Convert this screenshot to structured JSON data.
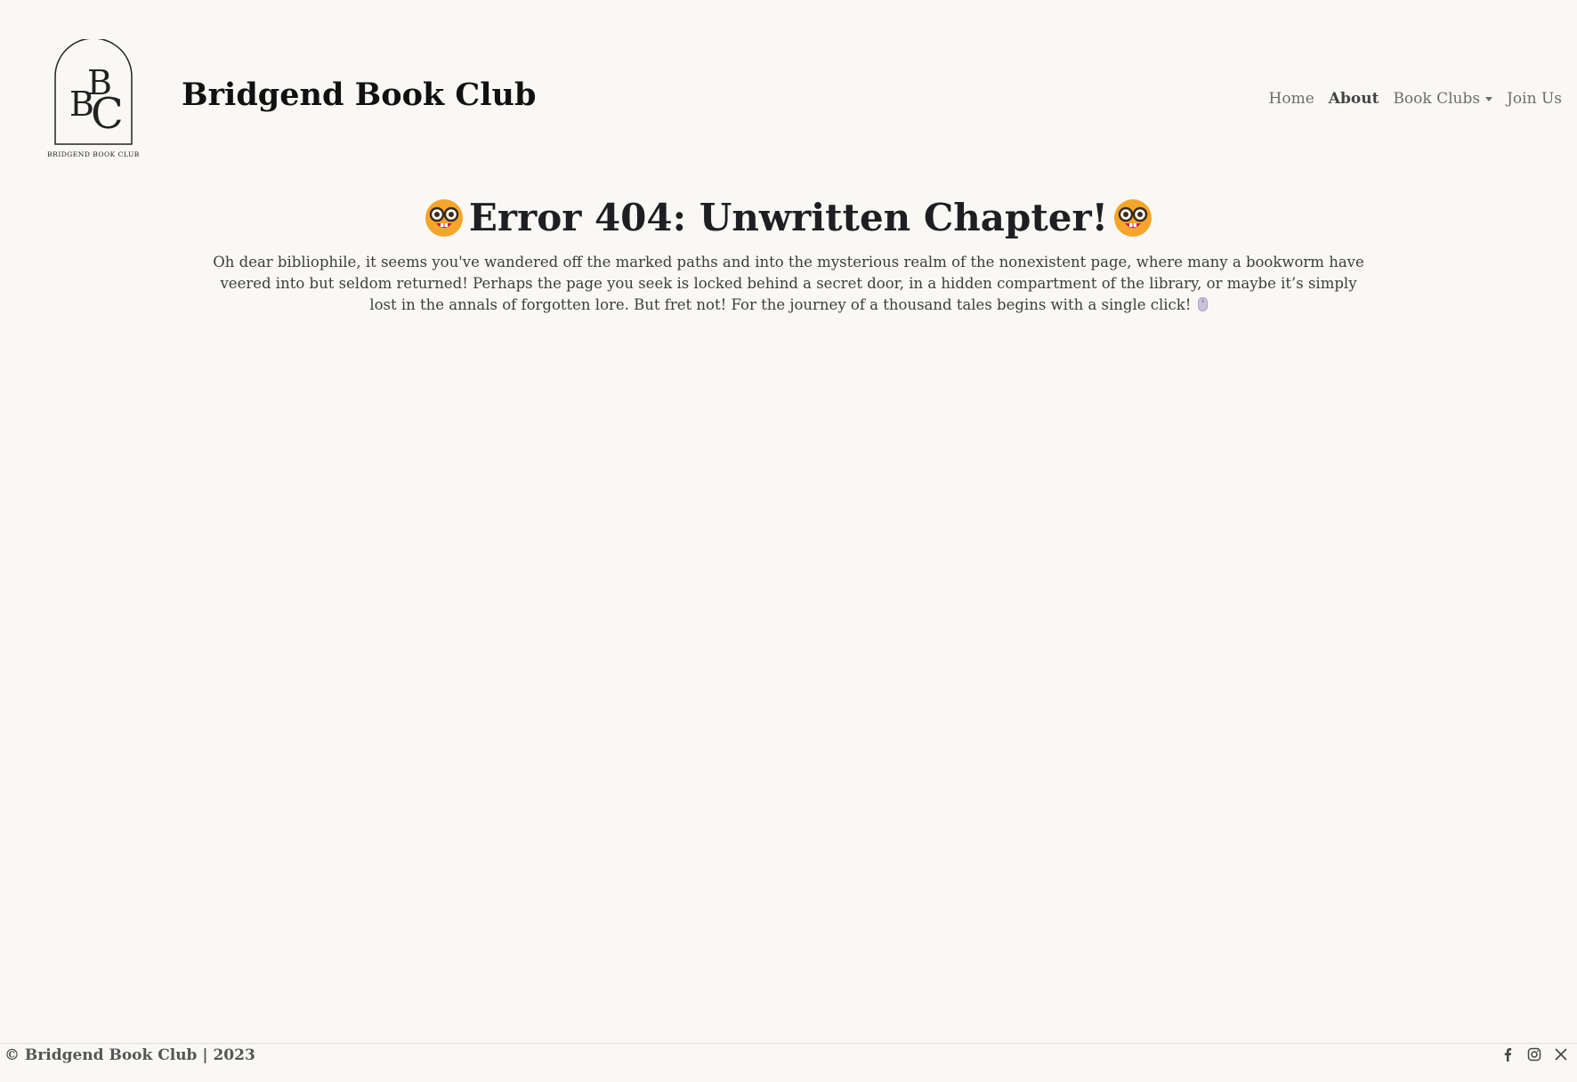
{
  "header": {
    "logo_text": "BRIDGEND BOOK CLUB",
    "brand": "Bridgend Book Club",
    "nav": {
      "home": "Home",
      "about": "About",
      "book_clubs": "Book Clubs",
      "join_us": "Join Us"
    }
  },
  "main": {
    "title": "Error 404: Unwritten Chapter!",
    "paragraph": "Oh dear bibliophile, it seems you've wandered off the marked paths and into the mysterious realm of the nonexistent page, where many a bookworm have veered into but seldom returned! Perhaps the page you seek is locked behind a secret door, in a hidden compartment of the library, or maybe it’s simply lost in the annals of forgotten lore. But fret not! For the journey of a thousand tales begins with a single click!"
  },
  "footer": {
    "copyright": "© Bridgend Book Club | 2023",
    "social": [
      "facebook-icon",
      "instagram-icon",
      "x-icon"
    ]
  },
  "colors": {
    "background": "#faf8f5",
    "text": "#212529",
    "nav": "#6c6c6c"
  }
}
